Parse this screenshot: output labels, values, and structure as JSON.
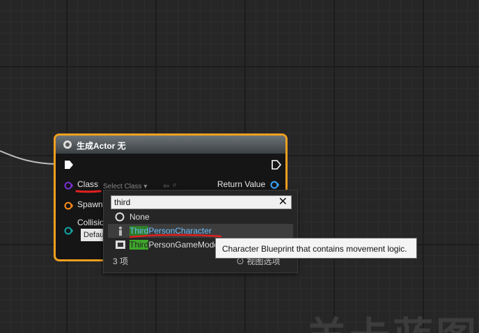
{
  "node": {
    "title": "生成Actor 无",
    "pins": {
      "class_label": "Class",
      "class_value": "Select Class",
      "spawn_label": "Spawn",
      "collision_label": "Collisio",
      "collision_value": "Defau",
      "return_label": "Return Value"
    }
  },
  "picker": {
    "search_value": "third",
    "items": [
      {
        "label": "None",
        "icon": "none-circle-icon"
      },
      {
        "highlight": "Third",
        "rest": "PersonCharacter",
        "icon": "character-icon",
        "selected": true
      },
      {
        "highlight": "Third",
        "rest": "PersonGameMode",
        "icon": "gamemode-icon"
      }
    ],
    "count": "3 项",
    "hidden_footer": "视图选项"
  },
  "tooltip": "Character Blueprint that contains movement logic.",
  "watermark": "羊卡蓝图",
  "colors": {
    "node_border": "#f0a020",
    "class_pin": "#7a2fd0",
    "spawn_pin": "#ff8c1a",
    "collision_pin": "#11a5a5",
    "return_pin": "#3aa7ff",
    "match_highlight": "#3fa82a",
    "annotation": "#e02020"
  }
}
